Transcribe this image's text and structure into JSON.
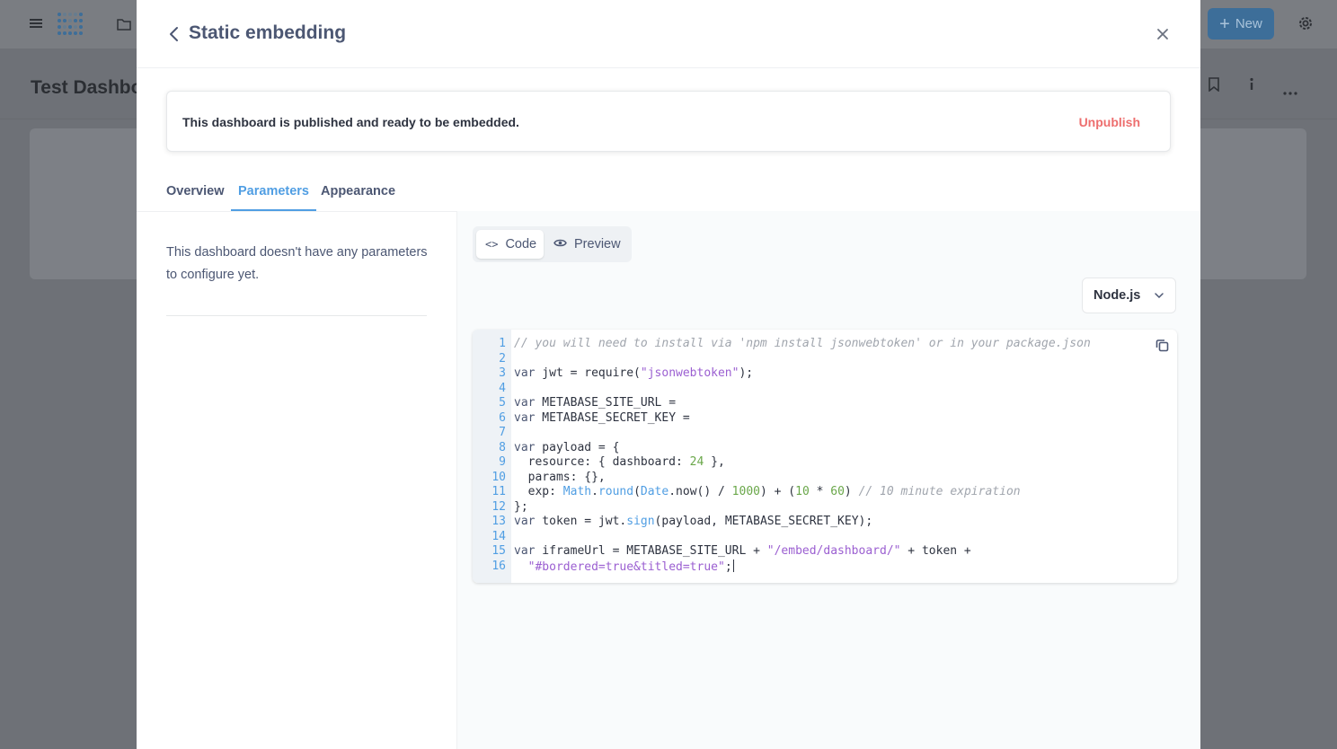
{
  "background": {
    "dashboard_title": "Test Dashboa",
    "new_button": "New"
  },
  "modal": {
    "title": "Static embedding",
    "banner": {
      "text": "This dashboard is published and ready to be embedded.",
      "unpublish": "Unpublish"
    },
    "tabs": [
      {
        "label": "Overview",
        "active": false
      },
      {
        "label": "Parameters",
        "active": true
      },
      {
        "label": "Appearance",
        "active": false
      }
    ],
    "no_params_text": "This dashboard doesn't have any parameters to configure yet.",
    "view_toggle": {
      "code": "Code",
      "preview": "Preview",
      "selected": "Code"
    },
    "language_select": {
      "value": "Node.js"
    },
    "code": {
      "lines": [
        {
          "n": "1",
          "tokens": [
            {
              "t": "// you will need to install via 'npm install jsonwebtoken' or in your package.json",
              "c": "comment"
            }
          ]
        },
        {
          "n": "2",
          "tokens": []
        },
        {
          "n": "3",
          "tokens": [
            {
              "t": "var",
              "c": "kw"
            },
            {
              "t": " jwt = require(",
              "c": ""
            },
            {
              "t": "\"jsonwebtoken\"",
              "c": "str"
            },
            {
              "t": ");",
              "c": ""
            }
          ]
        },
        {
          "n": "4",
          "tokens": []
        },
        {
          "n": "5",
          "tokens": [
            {
              "t": "var",
              "c": "kw"
            },
            {
              "t": " METABASE_SITE_URL =",
              "c": ""
            }
          ]
        },
        {
          "n": "6",
          "tokens": [
            {
              "t": "var",
              "c": "kw"
            },
            {
              "t": " METABASE_SECRET_KEY =",
              "c": ""
            }
          ]
        },
        {
          "n": "7",
          "tokens": []
        },
        {
          "n": "8",
          "tokens": [
            {
              "t": "var",
              "c": "kw"
            },
            {
              "t": " payload = {",
              "c": ""
            }
          ]
        },
        {
          "n": "9",
          "tokens": [
            {
              "t": "  resource: { dashboard: ",
              "c": ""
            },
            {
              "t": "24",
              "c": "num"
            },
            {
              "t": " },",
              "c": ""
            }
          ]
        },
        {
          "n": "10",
          "tokens": [
            {
              "t": "  params: {},",
              "c": ""
            }
          ]
        },
        {
          "n": "11",
          "tokens": [
            {
              "t": "  exp: ",
              "c": ""
            },
            {
              "t": "Math",
              "c": "obj"
            },
            {
              "t": ".",
              "c": ""
            },
            {
              "t": "round",
              "c": "fn"
            },
            {
              "t": "(",
              "c": ""
            },
            {
              "t": "Date",
              "c": "obj"
            },
            {
              "t": ".now() / ",
              "c": ""
            },
            {
              "t": "1000",
              "c": "num"
            },
            {
              "t": ") + (",
              "c": ""
            },
            {
              "t": "10",
              "c": "num"
            },
            {
              "t": " * ",
              "c": ""
            },
            {
              "t": "60",
              "c": "num"
            },
            {
              "t": ") ",
              "c": ""
            },
            {
              "t": "// 10 minute expiration",
              "c": "comment"
            }
          ]
        },
        {
          "n": "12",
          "tokens": [
            {
              "t": "};",
              "c": ""
            }
          ]
        },
        {
          "n": "13",
          "tokens": [
            {
              "t": "var",
              "c": "kw"
            },
            {
              "t": " token = jwt.",
              "c": ""
            },
            {
              "t": "sign",
              "c": "fn"
            },
            {
              "t": "(payload, METABASE_SECRET_KEY);",
              "c": ""
            }
          ]
        },
        {
          "n": "14",
          "tokens": []
        },
        {
          "n": "15",
          "tokens": [
            {
              "t": "var",
              "c": "kw"
            },
            {
              "t": " iframeUrl = METABASE_SITE_URL + ",
              "c": ""
            },
            {
              "t": "\"/embed/dashboard/\"",
              "c": "str"
            },
            {
              "t": " + token +",
              "c": ""
            }
          ]
        },
        {
          "n": "16",
          "tokens": [
            {
              "t": "  ",
              "c": ""
            },
            {
              "t": "\"#bordered=true&titled=true\"",
              "c": "str"
            },
            {
              "t": ";",
              "c": ""
            }
          ]
        }
      ]
    }
  },
  "colors": {
    "brand": "#509ee3",
    "danger": "#ed6e6e",
    "text_dark": "#2e3340",
    "text_medium": "#4c5773"
  },
  "icons": [
    "menu-icon",
    "metabase-logo-icon",
    "folder-icon",
    "plus-icon",
    "gear-icon",
    "bookmark-icon",
    "info-icon",
    "more-icon",
    "chevron-left-icon",
    "close-icon",
    "code-icon",
    "eye-icon",
    "chevron-down-icon",
    "copy-icon"
  ]
}
